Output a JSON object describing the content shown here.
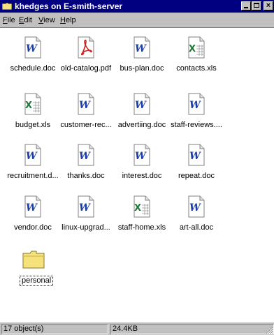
{
  "window": {
    "title": "khedges on E-smith-server",
    "controls": {
      "minimize": "minimize",
      "maximize": "maximize",
      "close": "×"
    }
  },
  "menu": [
    {
      "label": "File",
      "accel": "F",
      "rest": "ile"
    },
    {
      "label": "Edit",
      "accel": "E",
      "rest": "dit"
    },
    {
      "label": "View",
      "accel": "V",
      "rest": "iew"
    },
    {
      "label": "Help",
      "accel": "H",
      "rest": "elp"
    }
  ],
  "files": [
    {
      "name": "schedule.doc",
      "icon": "word-doc-icon"
    },
    {
      "name": "old-catalog.pdf",
      "icon": "pdf-icon"
    },
    {
      "name": "bus-plan.doc",
      "icon": "word-doc-icon"
    },
    {
      "name": "contacts.xls",
      "icon": "excel-xls-icon"
    },
    {
      "name": "budget.xls",
      "icon": "excel-xls-icon"
    },
    {
      "name": "customer-rec...",
      "icon": "word-doc-icon"
    },
    {
      "name": "advertiing.doc",
      "icon": "word-doc-icon"
    },
    {
      "name": "staff-reviews....",
      "icon": "word-doc-icon"
    },
    {
      "name": "recruitment.d...",
      "icon": "word-doc-icon"
    },
    {
      "name": "thanks.doc",
      "icon": "word-doc-icon"
    },
    {
      "name": "interest.doc",
      "icon": "word-doc-icon"
    },
    {
      "name": "repeat.doc",
      "icon": "word-doc-icon"
    },
    {
      "name": "vendor.doc",
      "icon": "word-doc-icon"
    },
    {
      "name": "linux-upgrad...",
      "icon": "word-doc-icon"
    },
    {
      "name": "staff-home.xls",
      "icon": "excel-xls-icon"
    },
    {
      "name": "art-all.doc",
      "icon": "word-doc-icon"
    },
    {
      "name": "personal",
      "icon": "folder-icon"
    }
  ],
  "status": {
    "objects": "17 object(s)",
    "size": "24.4KB"
  },
  "colors": {
    "titlebar": "#000080",
    "word_blue": "#1a3fa8",
    "excel_green": "#1f7a3a",
    "pdf_red": "#cc1f1f",
    "folder_yellow": "#f5e27a"
  }
}
